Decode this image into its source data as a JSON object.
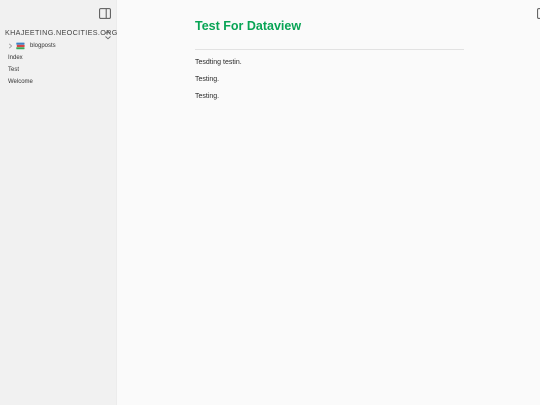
{
  "sidebar": {
    "vault_name": "KHAJEETING.NEOCITIES.ORG",
    "toggle_icon": "sidebar-panel-icon",
    "switch_icon": "chevron-up-down-icon",
    "tree": {
      "folder": {
        "label": "blogposts",
        "icon": "books-icon",
        "expanded": false
      },
      "files": [
        {
          "label": "Index"
        },
        {
          "label": "Test"
        },
        {
          "label": "Welcome"
        }
      ]
    }
  },
  "page": {
    "title": "Test For Dataview",
    "title_color": "#08a455",
    "paragraphs": [
      "Tesdting testin.",
      "Testing.",
      "Testing."
    ]
  }
}
